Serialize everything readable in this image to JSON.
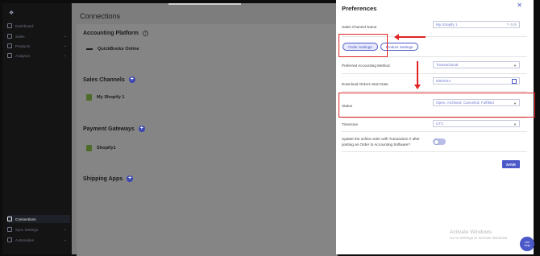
{
  "sidebar": {
    "items": [
      {
        "label": "Dashboard",
        "chevron": ""
      },
      {
        "label": "Sales",
        "chevron": "⌄"
      },
      {
        "label": "Products",
        "chevron": "⌄"
      },
      {
        "label": "Analytics",
        "chevron": "⌄"
      }
    ],
    "bottom_items": [
      {
        "label": "Connections",
        "chevron": ""
      },
      {
        "label": "Sync Settings",
        "chevron": "⌄"
      },
      {
        "label": "Automation",
        "chevron": "⌄"
      }
    ]
  },
  "main": {
    "title": "Connections",
    "accounting_platform": {
      "title": "Accounting Platform",
      "help_icon": "?",
      "item": "QuickBooks Online"
    },
    "sales_channels": {
      "title": "Sales Channels",
      "plus": "+",
      "item": "My Shopify 1"
    },
    "payment_gateways": {
      "title": "Payment Gateways",
      "plus": "+",
      "item": "Shopify1"
    },
    "shipping_apps": {
      "title": "Shipping Apps",
      "plus": "+"
    }
  },
  "preferences": {
    "title": "Preferences",
    "close": "✕",
    "sales_channel_name": {
      "label": "Sales Channel Name",
      "value": "My Shopify 1",
      "edit": "✎ Edit"
    },
    "tabs": [
      {
        "label": "Order Settings",
        "selected": true
      },
      {
        "label": "Product Settings",
        "selected": false
      }
    ],
    "accounting_method": {
      "label": "Preferred Accounting Method",
      "value": "Transactional"
    },
    "download_start_date": {
      "label": "Download Orders Start Date",
      "value": "5/8/2024"
    },
    "status": {
      "label": "Status",
      "value": "Open, Archived, Canceled, Fulfilled"
    },
    "timezone": {
      "label": "Timezone",
      "value": "UTC"
    },
    "update_online_order": {
      "label_line1": "Update the online order with Transaction # after",
      "label_line2": "posting an Order to Accounting Software?",
      "enabled": false
    },
    "save_label": "SAVE"
  },
  "watermark": {
    "title": "Activate Windows",
    "subtitle": "Go to Settings to activate Windows."
  },
  "chat_button": {
    "line1": "Live",
    "line2": "Help"
  },
  "colors": {
    "accent": "#4a58c8",
    "annotation": "#e02424",
    "sidebar_bg": "#141414"
  }
}
